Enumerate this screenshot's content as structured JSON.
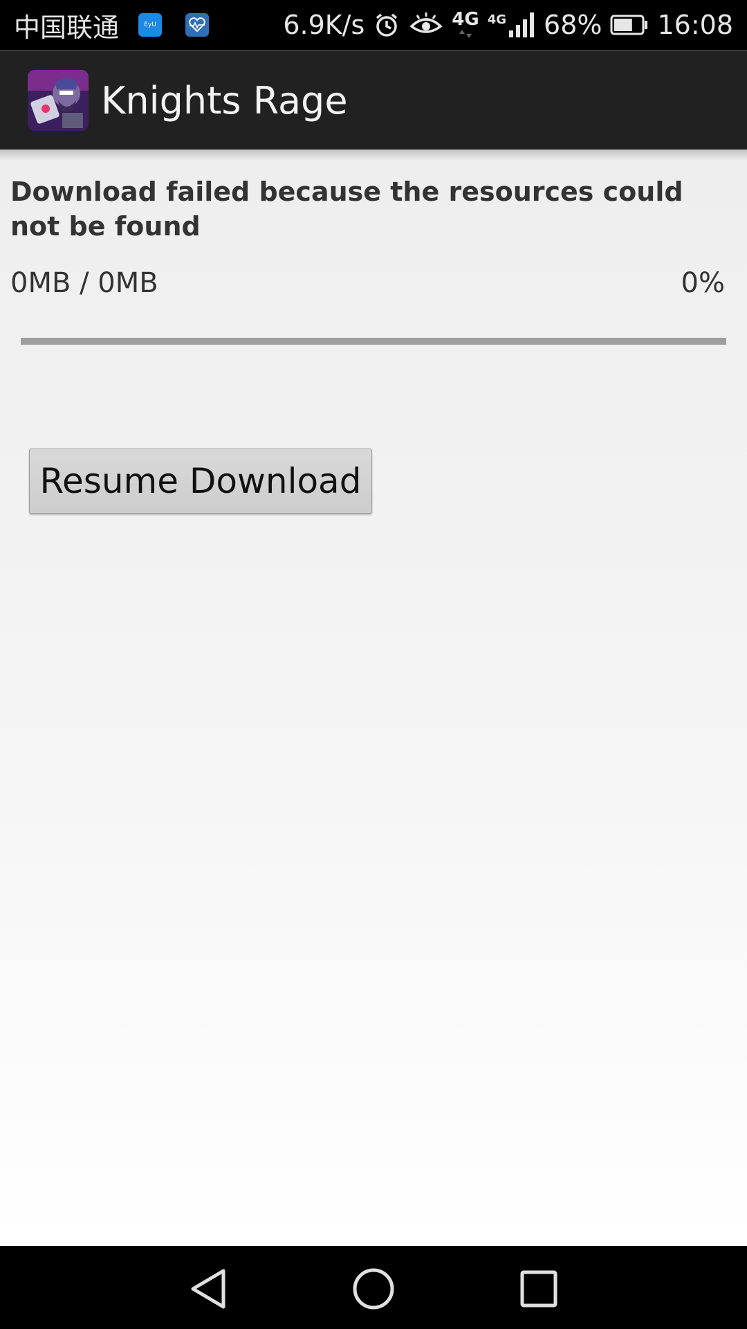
{
  "status_bar": {
    "carrier": "中国联通",
    "notif_icon_1_label": "EyU",
    "net_speed": "6.9K/s",
    "network_type": "4G",
    "signal_network_type": "4G",
    "battery_percent": "68%",
    "battery_level": 0.68,
    "time": "16:08",
    "icons": [
      "eyu-app-icon",
      "health-app-icon",
      "alarm-icon",
      "eye-comfort-icon",
      "data-arrows-icon",
      "signal-icon",
      "battery-icon"
    ]
  },
  "app_bar": {
    "title": "Knights Rage",
    "icon": "knights-rage-app-icon"
  },
  "download": {
    "status_message": "Download failed because the resources could not be found",
    "size_text": "0MB / 0MB",
    "percent_text": "0%",
    "progress": 0
  },
  "actions": {
    "resume_label": "Resume Download"
  },
  "nav_bar": {
    "icons": [
      "back-icon",
      "home-icon",
      "recent-apps-icon"
    ]
  },
  "colors": {
    "status_bar_bg": "#000000",
    "app_bar_bg": "#212121",
    "progress_track": "#9e9e9e",
    "button_bg": "#d4d4d4",
    "text": "#333333"
  }
}
